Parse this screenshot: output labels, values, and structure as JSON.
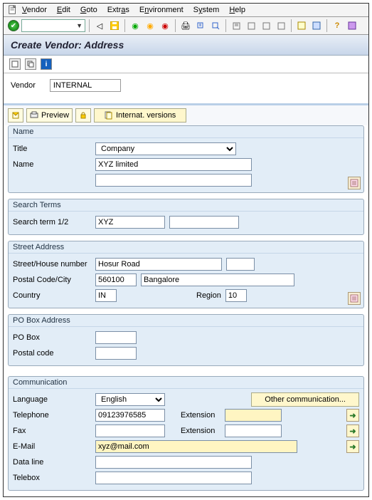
{
  "menu": {
    "items": [
      "Vendor",
      "Edit",
      "Goto",
      "Extras",
      "Environment",
      "System",
      "Help"
    ]
  },
  "title": "Create Vendor: Address",
  "vendor": {
    "label": "Vendor",
    "value": "INTERNAL"
  },
  "actions": {
    "preview": "Preview",
    "internat": "Internat. versions"
  },
  "sections": {
    "name": {
      "title": "Name",
      "title_label": "Title",
      "title_value": "Company",
      "name_label": "Name",
      "name_value": "XYZ limited"
    },
    "search": {
      "title": "Search Terms",
      "term_label": "Search term 1/2",
      "term1": "XYZ",
      "term2": ""
    },
    "street": {
      "title": "Street Address",
      "street_label": "Street/House number",
      "street_value": "Hosur Road",
      "house_value": "",
      "postal_label": "Postal Code/City",
      "postal_value": "560100",
      "city_value": "Bangalore",
      "country_label": "Country",
      "country_value": "IN",
      "region_label": "Region",
      "region_value": "10"
    },
    "pobox": {
      "title": "PO Box Address",
      "pobox_label": "PO Box",
      "pobox_value": "",
      "postal_label": "Postal code",
      "postal_value": ""
    },
    "comm": {
      "title": "Communication",
      "lang_label": "Language",
      "lang_value": "English",
      "other_btn": "Other communication...",
      "tel_label": "Telephone",
      "tel_value": "09123976585",
      "ext_label": "Extension",
      "ext1": "",
      "fax_label": "Fax",
      "fax_value": "",
      "ext2": "",
      "email_label": "E-Mail",
      "email_value": "xyz@mail.com",
      "dataline_label": "Data line",
      "dataline_value": "",
      "telebox_label": "Telebox",
      "telebox_value": ""
    }
  }
}
